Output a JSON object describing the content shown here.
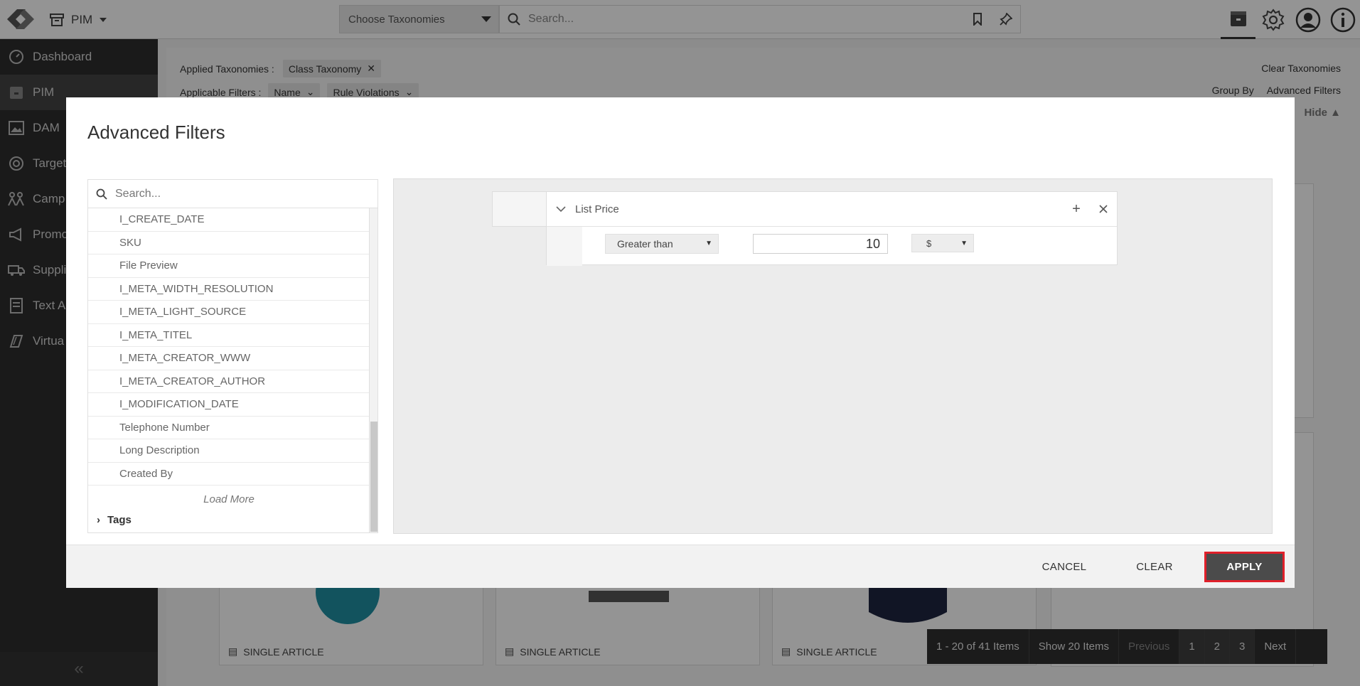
{
  "topbar": {
    "module": "PIM",
    "taxonomy_select": "Choose Taxonomies",
    "search_placeholder": "Search..."
  },
  "sidebar": {
    "items": [
      {
        "label": "Dashboard",
        "icon": "dashboard-icon"
      },
      {
        "label": "PIM",
        "icon": "pim-box-icon"
      },
      {
        "label": "DAM",
        "icon": "image-icon"
      },
      {
        "label": "Target",
        "icon": "target-icon"
      },
      {
        "label": "Camp",
        "icon": "campaign-icon"
      },
      {
        "label": "Promo",
        "icon": "megaphone-icon"
      },
      {
        "label": "Suppli",
        "icon": "truck-icon"
      },
      {
        "label": "Text A",
        "icon": "document-icon"
      },
      {
        "label": "Virtua",
        "icon": "layers-icon"
      }
    ],
    "collapse": "«"
  },
  "main": {
    "applied_taxonomies_label": "Applied Taxonomies :",
    "applied_taxonomy_chip": "Class Taxonomy",
    "applicable_filters_label": "Applicable Filters :",
    "filters": [
      "Name",
      "Rule Violations"
    ],
    "clear_taxonomies": "Clear Taxonomies",
    "group_by": "Group By",
    "advanced_filters": "Advanced Filters",
    "hide": "Hide ▲",
    "card_label": "SINGLE ARTICLE"
  },
  "pager": {
    "range": "1 - 20 of 41 Items",
    "show": "Show 20 Items",
    "previous": "Previous",
    "pages": [
      "1",
      "2",
      "3"
    ],
    "next": "Next"
  },
  "modal": {
    "title": "Advanced Filters",
    "search_placeholder": "Search...",
    "attributes": [
      "I_CREATE_DATE",
      "SKU",
      "File Preview",
      "I_META_WIDTH_RESOLUTION",
      "I_META_LIGHT_SOURCE",
      "I_META_TITEL",
      "I_META_CREATOR_WWW",
      "I_META_CREATOR_AUTHOR",
      "I_MODIFICATION_DATE",
      "Telephone Number",
      "Long Description",
      "Created By"
    ],
    "load_more": "Load More",
    "tags": "Tags",
    "rule": {
      "name": "List Price",
      "operator": "Greater than",
      "value": "10",
      "currency": "$"
    },
    "buttons": {
      "cancel": "CANCEL",
      "clear": "CLEAR",
      "apply": "APPLY"
    },
    "highlight_color": "#e0202a"
  }
}
